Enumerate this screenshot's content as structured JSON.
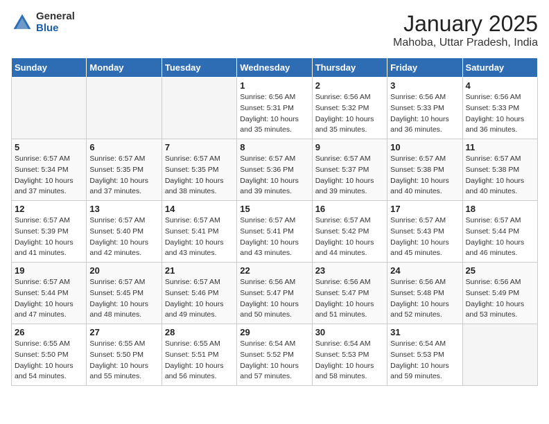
{
  "logo": {
    "general": "General",
    "blue": "Blue"
  },
  "header": {
    "month": "January 2025",
    "location": "Mahoba, Uttar Pradesh, India"
  },
  "weekdays": [
    "Sunday",
    "Monday",
    "Tuesday",
    "Wednesday",
    "Thursday",
    "Friday",
    "Saturday"
  ],
  "weeks": [
    [
      {
        "day": "",
        "info": ""
      },
      {
        "day": "",
        "info": ""
      },
      {
        "day": "",
        "info": ""
      },
      {
        "day": "1",
        "sunrise": "Sunrise: 6:56 AM",
        "sunset": "Sunset: 5:31 PM",
        "daylight": "Daylight: 10 hours and 35 minutes."
      },
      {
        "day": "2",
        "sunrise": "Sunrise: 6:56 AM",
        "sunset": "Sunset: 5:32 PM",
        "daylight": "Daylight: 10 hours and 35 minutes."
      },
      {
        "day": "3",
        "sunrise": "Sunrise: 6:56 AM",
        "sunset": "Sunset: 5:33 PM",
        "daylight": "Daylight: 10 hours and 36 minutes."
      },
      {
        "day": "4",
        "sunrise": "Sunrise: 6:56 AM",
        "sunset": "Sunset: 5:33 PM",
        "daylight": "Daylight: 10 hours and 36 minutes."
      }
    ],
    [
      {
        "day": "5",
        "sunrise": "Sunrise: 6:57 AM",
        "sunset": "Sunset: 5:34 PM",
        "daylight": "Daylight: 10 hours and 37 minutes."
      },
      {
        "day": "6",
        "sunrise": "Sunrise: 6:57 AM",
        "sunset": "Sunset: 5:35 PM",
        "daylight": "Daylight: 10 hours and 37 minutes."
      },
      {
        "day": "7",
        "sunrise": "Sunrise: 6:57 AM",
        "sunset": "Sunset: 5:35 PM",
        "daylight": "Daylight: 10 hours and 38 minutes."
      },
      {
        "day": "8",
        "sunrise": "Sunrise: 6:57 AM",
        "sunset": "Sunset: 5:36 PM",
        "daylight": "Daylight: 10 hours and 39 minutes."
      },
      {
        "day": "9",
        "sunrise": "Sunrise: 6:57 AM",
        "sunset": "Sunset: 5:37 PM",
        "daylight": "Daylight: 10 hours and 39 minutes."
      },
      {
        "day": "10",
        "sunrise": "Sunrise: 6:57 AM",
        "sunset": "Sunset: 5:38 PM",
        "daylight": "Daylight: 10 hours and 40 minutes."
      },
      {
        "day": "11",
        "sunrise": "Sunrise: 6:57 AM",
        "sunset": "Sunset: 5:38 PM",
        "daylight": "Daylight: 10 hours and 40 minutes."
      }
    ],
    [
      {
        "day": "12",
        "sunrise": "Sunrise: 6:57 AM",
        "sunset": "Sunset: 5:39 PM",
        "daylight": "Daylight: 10 hours and 41 minutes."
      },
      {
        "day": "13",
        "sunrise": "Sunrise: 6:57 AM",
        "sunset": "Sunset: 5:40 PM",
        "daylight": "Daylight: 10 hours and 42 minutes."
      },
      {
        "day": "14",
        "sunrise": "Sunrise: 6:57 AM",
        "sunset": "Sunset: 5:41 PM",
        "daylight": "Daylight: 10 hours and 43 minutes."
      },
      {
        "day": "15",
        "sunrise": "Sunrise: 6:57 AM",
        "sunset": "Sunset: 5:41 PM",
        "daylight": "Daylight: 10 hours and 43 minutes."
      },
      {
        "day": "16",
        "sunrise": "Sunrise: 6:57 AM",
        "sunset": "Sunset: 5:42 PM",
        "daylight": "Daylight: 10 hours and 44 minutes."
      },
      {
        "day": "17",
        "sunrise": "Sunrise: 6:57 AM",
        "sunset": "Sunset: 5:43 PM",
        "daylight": "Daylight: 10 hours and 45 minutes."
      },
      {
        "day": "18",
        "sunrise": "Sunrise: 6:57 AM",
        "sunset": "Sunset: 5:44 PM",
        "daylight": "Daylight: 10 hours and 46 minutes."
      }
    ],
    [
      {
        "day": "19",
        "sunrise": "Sunrise: 6:57 AM",
        "sunset": "Sunset: 5:44 PM",
        "daylight": "Daylight: 10 hours and 47 minutes."
      },
      {
        "day": "20",
        "sunrise": "Sunrise: 6:57 AM",
        "sunset": "Sunset: 5:45 PM",
        "daylight": "Daylight: 10 hours and 48 minutes."
      },
      {
        "day": "21",
        "sunrise": "Sunrise: 6:57 AM",
        "sunset": "Sunset: 5:46 PM",
        "daylight": "Daylight: 10 hours and 49 minutes."
      },
      {
        "day": "22",
        "sunrise": "Sunrise: 6:56 AM",
        "sunset": "Sunset: 5:47 PM",
        "daylight": "Daylight: 10 hours and 50 minutes."
      },
      {
        "day": "23",
        "sunrise": "Sunrise: 6:56 AM",
        "sunset": "Sunset: 5:47 PM",
        "daylight": "Daylight: 10 hours and 51 minutes."
      },
      {
        "day": "24",
        "sunrise": "Sunrise: 6:56 AM",
        "sunset": "Sunset: 5:48 PM",
        "daylight": "Daylight: 10 hours and 52 minutes."
      },
      {
        "day": "25",
        "sunrise": "Sunrise: 6:56 AM",
        "sunset": "Sunset: 5:49 PM",
        "daylight": "Daylight: 10 hours and 53 minutes."
      }
    ],
    [
      {
        "day": "26",
        "sunrise": "Sunrise: 6:55 AM",
        "sunset": "Sunset: 5:50 PM",
        "daylight": "Daylight: 10 hours and 54 minutes."
      },
      {
        "day": "27",
        "sunrise": "Sunrise: 6:55 AM",
        "sunset": "Sunset: 5:50 PM",
        "daylight": "Daylight: 10 hours and 55 minutes."
      },
      {
        "day": "28",
        "sunrise": "Sunrise: 6:55 AM",
        "sunset": "Sunset: 5:51 PM",
        "daylight": "Daylight: 10 hours and 56 minutes."
      },
      {
        "day": "29",
        "sunrise": "Sunrise: 6:54 AM",
        "sunset": "Sunset: 5:52 PM",
        "daylight": "Daylight: 10 hours and 57 minutes."
      },
      {
        "day": "30",
        "sunrise": "Sunrise: 6:54 AM",
        "sunset": "Sunset: 5:53 PM",
        "daylight": "Daylight: 10 hours and 58 minutes."
      },
      {
        "day": "31",
        "sunrise": "Sunrise: 6:54 AM",
        "sunset": "Sunset: 5:53 PM",
        "daylight": "Daylight: 10 hours and 59 minutes."
      },
      {
        "day": "",
        "info": ""
      }
    ]
  ]
}
